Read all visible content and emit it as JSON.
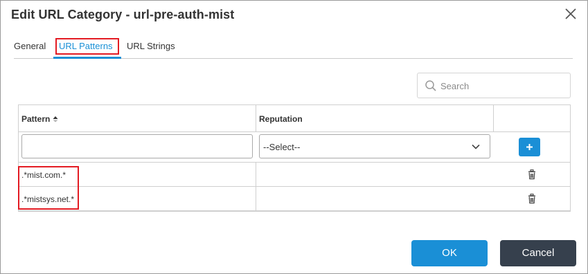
{
  "dialog": {
    "title": "Edit URL Category - url-pre-auth-mist",
    "close_icon": "close-icon"
  },
  "tabs": [
    {
      "label": "General",
      "active": false
    },
    {
      "label": "URL Patterns",
      "active": true
    },
    {
      "label": "URL Strings",
      "active": false
    }
  ],
  "search": {
    "placeholder": "Search",
    "value": "",
    "icon": "search-icon"
  },
  "table": {
    "columns": [
      {
        "label": "Pattern",
        "sort": "ascending"
      },
      {
        "label": "Reputation"
      }
    ],
    "new_row": {
      "pattern_value": "",
      "reputation_selected": "--Select--",
      "add_icon": "plus-icon"
    },
    "rows": [
      {
        "pattern": ".*mist.com.*",
        "reputation": ""
      },
      {
        "pattern": ".*mistsys.net.*",
        "reputation": ""
      }
    ],
    "row_action_icon": "trash-icon"
  },
  "footer": {
    "ok_label": "OK",
    "cancel_label": "Cancel"
  },
  "colors": {
    "accent": "#1a8fd6",
    "cancel_bg": "#36404d",
    "highlight": "#e31b23"
  }
}
